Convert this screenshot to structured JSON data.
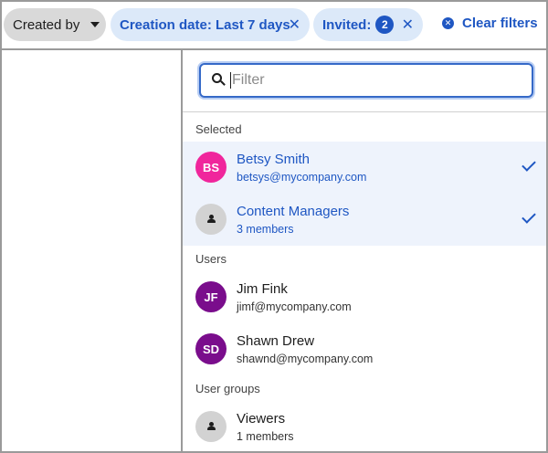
{
  "filterbar": {
    "created_by": "Created by",
    "date_chip": "Creation date: Last 7 days",
    "invited_chip": "Invited:",
    "invited_count": "2",
    "clear_filters": "Clear filters",
    "remove_symbol": "✕"
  },
  "search": {
    "placeholder": "Filter",
    "value": ""
  },
  "sections": {
    "selected": "Selected",
    "users": "Users",
    "groups": "User groups"
  },
  "selected": [
    {
      "initials": "BS",
      "name": "Betsy Smith",
      "sub": "betsys@mycompany.com",
      "color": "#f0269c"
    },
    {
      "initials": "",
      "name": "Content Managers",
      "sub": "3 members",
      "icon": "person-icon"
    }
  ],
  "users": [
    {
      "initials": "JF",
      "name": "Jim Fink",
      "sub": "jimf@mycompany.com",
      "color": "#7a0d8c"
    },
    {
      "initials": "SD",
      "name": "Shawn Drew",
      "sub": "shawnd@mycompany.com",
      "color": "#7a0d8c"
    }
  ],
  "groups": [
    {
      "initials": "",
      "name": "Viewers",
      "sub": "1 members",
      "icon": "person-icon"
    }
  ]
}
